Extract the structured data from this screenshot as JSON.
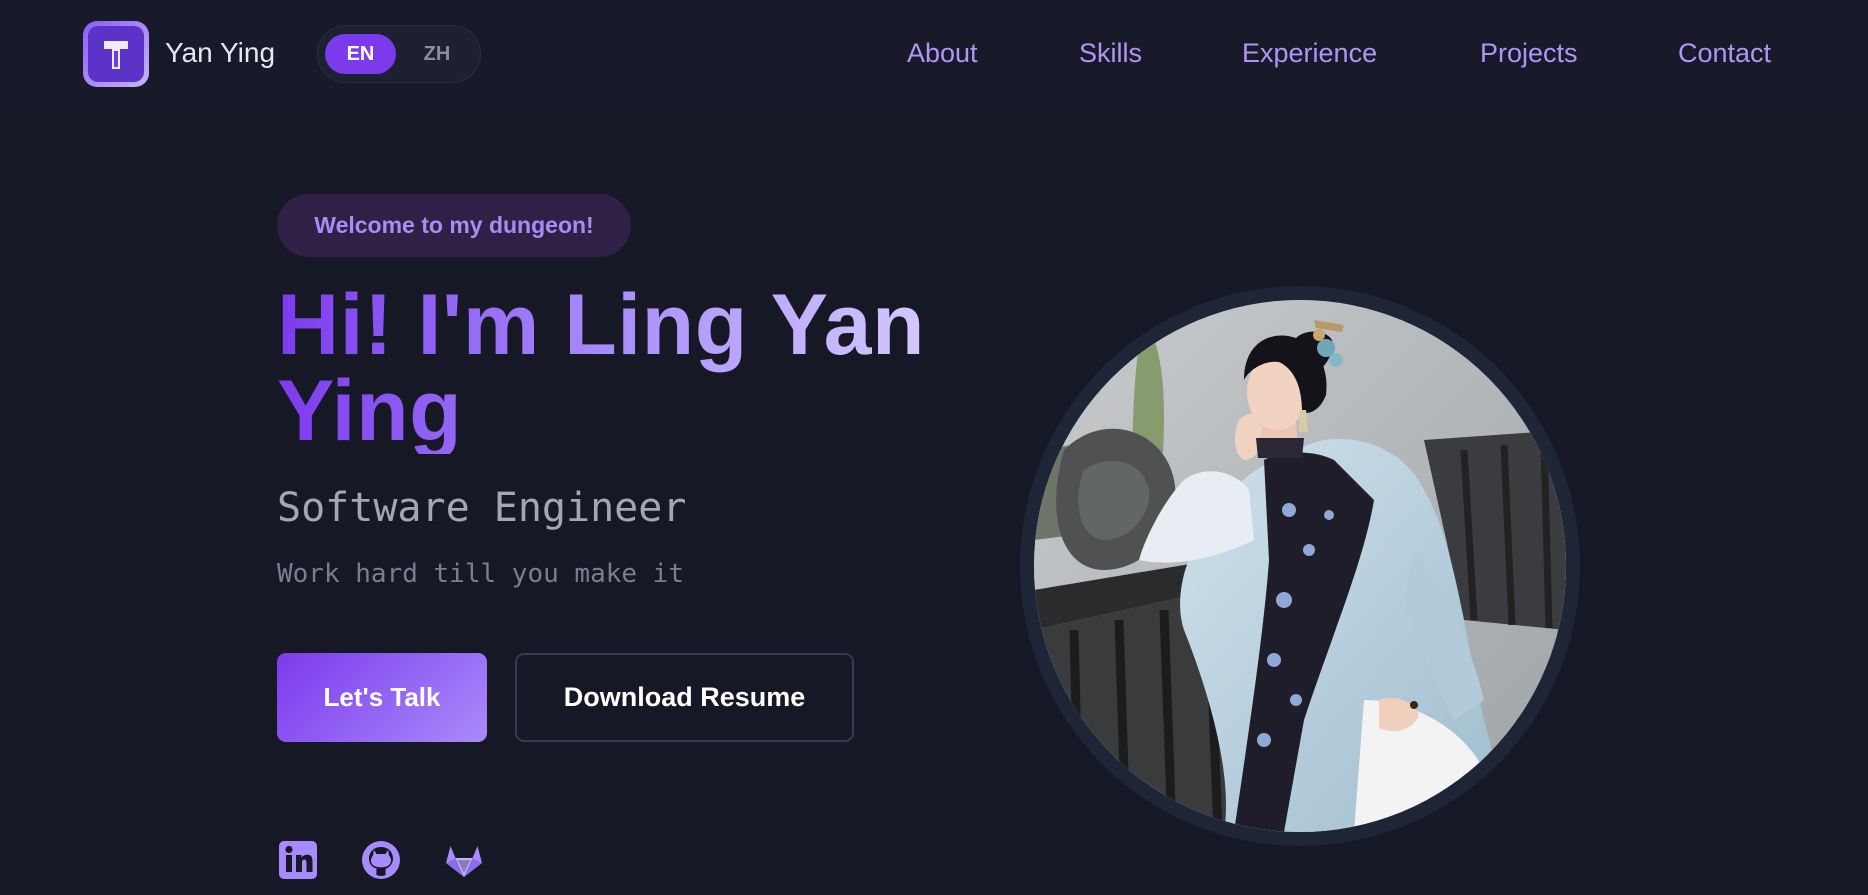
{
  "header": {
    "brand_name": "Yan Ying",
    "logo_icon": "t-logo-icon",
    "language": {
      "options": [
        "EN",
        "ZH"
      ],
      "selected": "EN"
    },
    "nav": [
      "About",
      "Skills",
      "Experience",
      "Projects",
      "Contact"
    ]
  },
  "hero": {
    "badge": "Welcome to my dungeon!",
    "headline_line1": "Hi! I'm Ling Yan",
    "headline_line2": "Ying",
    "subtitle": "Software Engineer",
    "motto": "Work hard till you make it",
    "primary_button": "Let's Talk",
    "secondary_button": "Download Resume",
    "social_icons": [
      "linkedin-icon",
      "github-icon",
      "gitlab-icon"
    ]
  },
  "colors": {
    "background": "#161925",
    "header_bg": "#181a2a",
    "accent": "#7c3aed",
    "accent_light": "#a78bfa",
    "nav_text": "#b195f5"
  }
}
